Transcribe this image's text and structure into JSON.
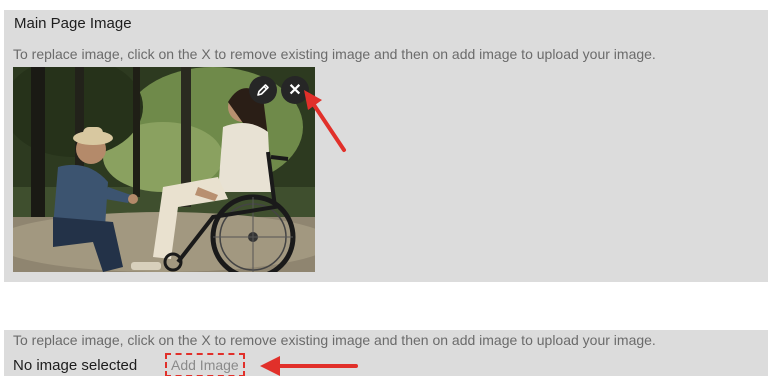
{
  "main_section": {
    "title": "Main Page Image",
    "instructions": "To replace image, click on the X to remove existing image and then on add image to upload your image.",
    "image_buttons": {
      "edit_icon": "pencil-icon",
      "remove_label": "✕"
    }
  },
  "lower_section": {
    "instructions": "To replace image, click on the X to remove existing image and then on add image to upload your image.",
    "no_image_label": "No image selected",
    "add_image_label": "Add Image"
  },
  "colors": {
    "annotation_red": "#e1302a",
    "panel_bg": "#dcdcdc",
    "hint_text": "#6b6b6b"
  }
}
